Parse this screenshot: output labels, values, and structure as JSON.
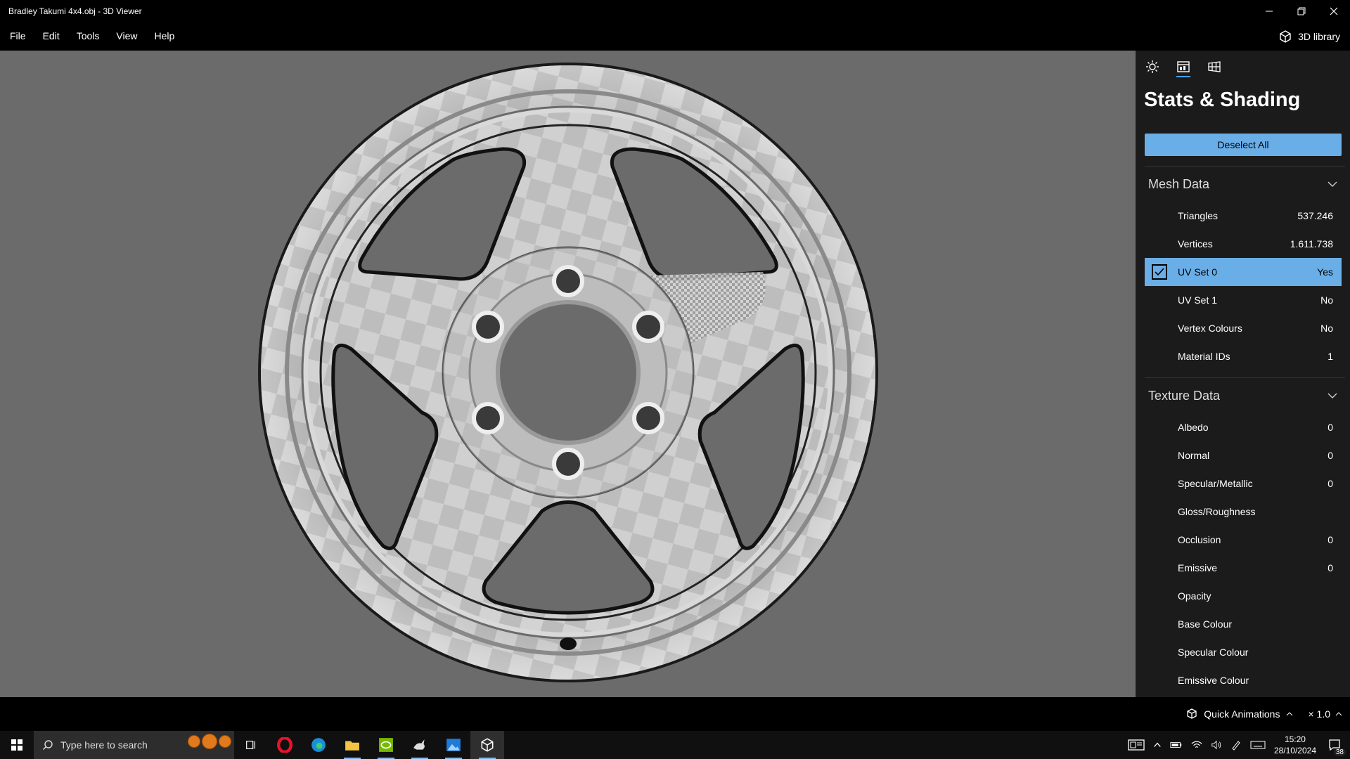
{
  "window": {
    "title": "Bradley Takumi 4x4.obj - 3D Viewer"
  },
  "menu": {
    "items": [
      "File",
      "Edit",
      "Tools",
      "View",
      "Help"
    ],
    "library_label": "3D library"
  },
  "panel": {
    "title": "Stats & Shading",
    "deselect_label": "Deselect All",
    "mesh_section": "Mesh Data",
    "mesh_rows": [
      {
        "label": "Triangles",
        "value": "537.246"
      },
      {
        "label": "Vertices",
        "value": "1.611.738"
      },
      {
        "label": "UV Set 0",
        "value": "Yes"
      },
      {
        "label": "UV Set 1",
        "value": "No"
      },
      {
        "label": "Vertex Colours",
        "value": "No"
      },
      {
        "label": "Material IDs",
        "value": "1"
      }
    ],
    "texture_section": "Texture Data",
    "texture_rows": [
      {
        "label": "Albedo",
        "value": "0"
      },
      {
        "label": "Normal",
        "value": "0"
      },
      {
        "label": "Specular/Metallic",
        "value": "0"
      },
      {
        "label": "Gloss/Roughness",
        "value": ""
      },
      {
        "label": "Occlusion",
        "value": "0"
      },
      {
        "label": "Emissive",
        "value": "0"
      },
      {
        "label": "Opacity",
        "value": ""
      },
      {
        "label": "Base Colour",
        "value": ""
      },
      {
        "label": "Specular Colour",
        "value": ""
      },
      {
        "label": "Emissive Colour",
        "value": ""
      }
    ]
  },
  "status": {
    "quick_animations": "Quick Animations",
    "speed": "× 1.0"
  },
  "taskbar": {
    "search_placeholder": "Type here to search",
    "time": "15:20",
    "date": "28/10/2024",
    "notification_count": "38"
  },
  "colors": {
    "accent": "#6aaee8",
    "viewport_bg": "#6b6b6b",
    "panel_bg": "#1b1b1b"
  }
}
